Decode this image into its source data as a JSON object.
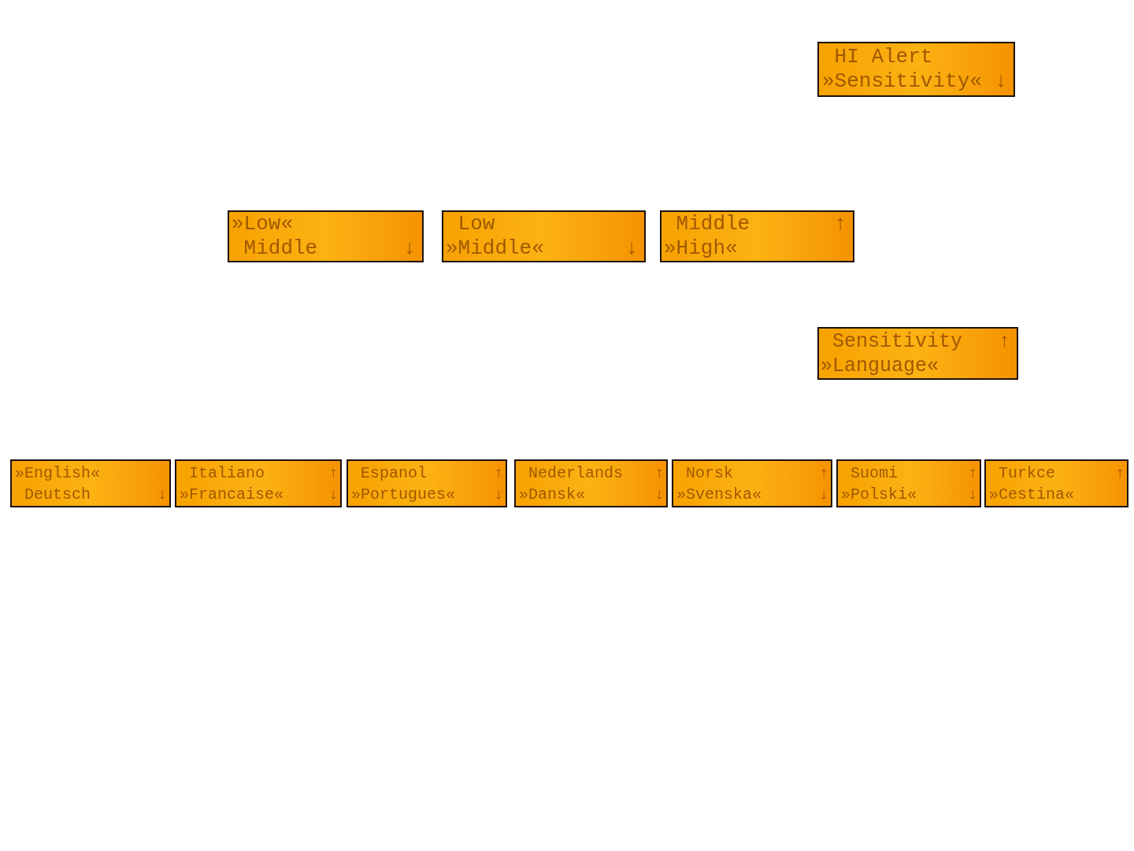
{
  "rows": [
    {
      "displays": [
        {
          "lines": [
            {
              "text": "HI Alert",
              "kind": "plain"
            },
            {
              "text": "»Sensitivity«",
              "kind": "marked",
              "arrow": "↓"
            }
          ]
        }
      ]
    },
    {
      "displays": [
        {
          "lines": [
            {
              "text": "»Low«",
              "kind": "marked"
            },
            {
              "text": "Middle",
              "kind": "plain",
              "arrow": "↓"
            }
          ]
        },
        {
          "lines": [
            {
              "text": "Low",
              "kind": "plain"
            },
            {
              "text": "»Middle«",
              "kind": "marked",
              "arrow": "↓"
            }
          ]
        },
        {
          "lines": [
            {
              "text": "Middle",
              "kind": "plain",
              "arrow": "↑"
            },
            {
              "text": "»High«",
              "kind": "marked"
            }
          ]
        }
      ]
    },
    {
      "displays": [
        {
          "lines": [
            {
              "text": "Sensitivity",
              "kind": "plain",
              "arrow": "↑"
            },
            {
              "text": "»Language«",
              "kind": "marked"
            }
          ]
        }
      ]
    },
    {
      "displays": [
        {
          "lines": [
            {
              "text": "»English«",
              "kind": "marked"
            },
            {
              "text": "Deutsch",
              "kind": "plain",
              "arrow": "↓"
            }
          ]
        },
        {
          "lines": [
            {
              "text": "Italiano",
              "kind": "plain",
              "arrow": "↑"
            },
            {
              "text": "»Francaise«",
              "kind": "marked",
              "arrow": "↓"
            }
          ]
        },
        {
          "lines": [
            {
              "text": "Espanol",
              "kind": "plain",
              "arrow": "↑"
            },
            {
              "text": "»Portugues«",
              "kind": "marked",
              "arrow": "↓"
            }
          ]
        },
        {
          "lines": [
            {
              "text": "Nederlands",
              "kind": "plain",
              "arrow": "↑"
            },
            {
              "text": "»Dansk«",
              "kind": "marked",
              "arrow": "↓"
            }
          ]
        },
        {
          "lines": [
            {
              "text": "Norsk",
              "kind": "plain",
              "arrow": "↑"
            },
            {
              "text": "»Svenska«",
              "kind": "marked",
              "arrow": "↓"
            }
          ]
        },
        {
          "lines": [
            {
              "text": "Suomi",
              "kind": "plain",
              "arrow": "↑"
            },
            {
              "text": "»Polski«",
              "kind": "marked",
              "arrow": "↓"
            }
          ]
        },
        {
          "lines": [
            {
              "text": "Turkce",
              "kind": "plain",
              "arrow": "↑"
            },
            {
              "text": "»Cestina«",
              "kind": "marked"
            }
          ]
        }
      ]
    }
  ]
}
